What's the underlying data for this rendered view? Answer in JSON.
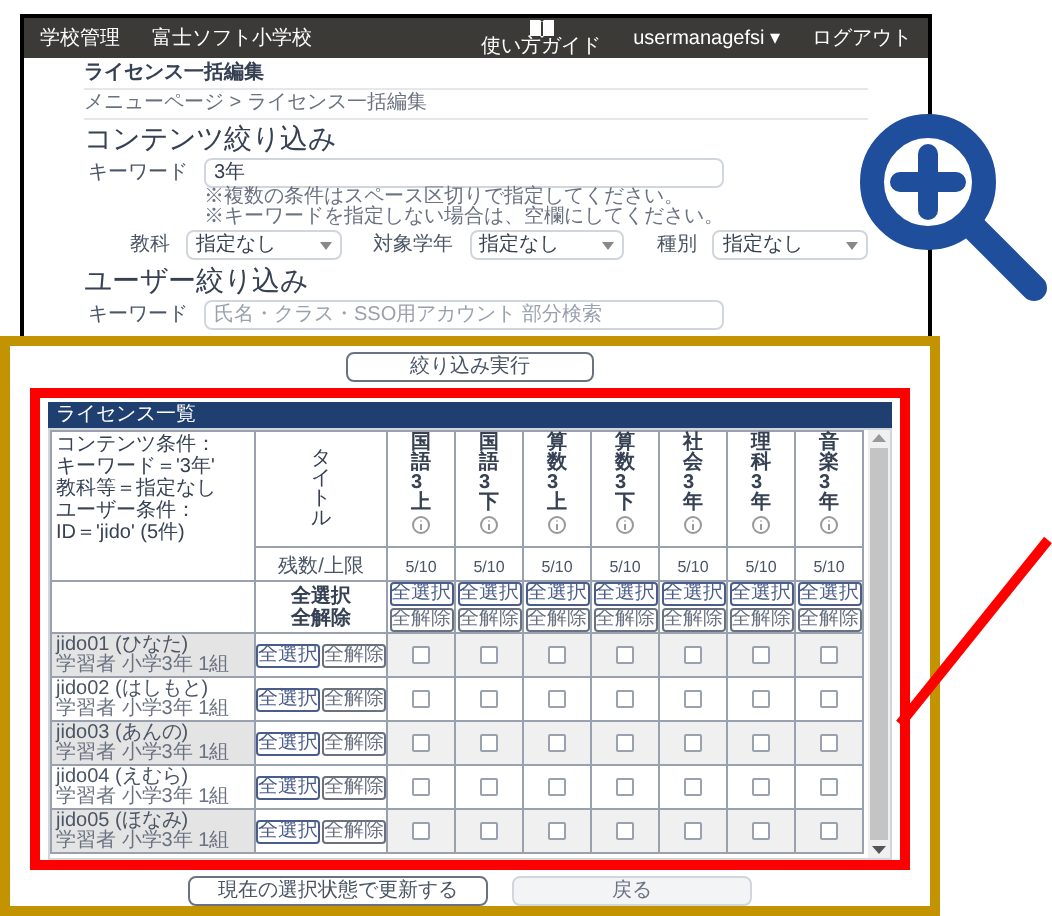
{
  "header": {
    "app": "学校管理",
    "school": "富士ソフト小学校",
    "guide": "使い方ガイド",
    "user": "usermanagefsi ▾",
    "logout": "ログアウト"
  },
  "page_title": "ライセンス一括編集",
  "breadcrumb": "メニューページ > ライセンス一括編集",
  "content_filter": {
    "heading": "コンテンツ絞り込み",
    "keyword": {
      "label": "キーワード",
      "value": "3年"
    },
    "hints": [
      "※複数の条件はスペース区切りで指定してください。",
      "※キーワードを指定しない場合は、空欄にしてください。"
    ],
    "selects": [
      {
        "label": "教科",
        "value": "指定なし"
      },
      {
        "label": "対象学年",
        "value": "指定なし"
      },
      {
        "label": "種別",
        "value": "指定なし"
      }
    ]
  },
  "user_filter": {
    "heading": "ユーザー絞り込み",
    "keyword": {
      "label": "キーワード",
      "placeholder": "氏名・クラス・SSO用アカウント 部分検索"
    }
  },
  "run_button": "絞り込み実行",
  "license_table": {
    "title": "ライセンス一覧",
    "conditions": [
      "コンテンツ条件：",
      "キーワード＝'3年'",
      "教科等＝指定なし",
      "ユーザー条件：",
      "ID＝'jido' (5件)"
    ],
    "title_label": "タイトル",
    "count_label": "残数/上限",
    "select_labels": [
      "全選択",
      "全解除"
    ],
    "columns": [
      {
        "title": "国語3上",
        "count": "5/10",
        "buttons": [
          "全選択",
          "全解除"
        ]
      },
      {
        "title": "国語3下",
        "count": "5/10",
        "buttons": [
          "全選択",
          "全解除"
        ]
      },
      {
        "title": "算数3上",
        "count": "5/10",
        "buttons": [
          "全選択",
          "全解除"
        ]
      },
      {
        "title": "算数3下",
        "count": "5/10",
        "buttons": [
          "全選択",
          "全解除"
        ]
      },
      {
        "title": "社会3年",
        "count": "5/10",
        "buttons": [
          "全選択",
          "全解除"
        ]
      },
      {
        "title": "理科3年",
        "count": "5/10",
        "buttons": [
          "全選択",
          "全解除"
        ]
      },
      {
        "title": "音楽3年",
        "count": "5/10",
        "buttons": [
          "全選択",
          "全解除"
        ]
      }
    ],
    "rows": [
      {
        "user": "jido01 (ひなた)",
        "detail": "学習者 小学3年 1組",
        "buttons": [
          "全選択",
          "全解除"
        ],
        "cells": [
          {
            "checked": false
          },
          {
            "checked": false
          },
          {
            "checked": false
          },
          {
            "checked": false
          },
          {
            "checked": false
          },
          {
            "checked": false
          },
          {
            "checked": false
          }
        ]
      },
      {
        "user": "jido02 (はしもと)",
        "detail": "学習者 小学3年 1組",
        "buttons": [
          "全選択",
          "全解除"
        ],
        "cells": [
          {
            "checked": false
          },
          {
            "checked": false
          },
          {
            "checked": false
          },
          {
            "checked": false
          },
          {
            "checked": false
          },
          {
            "checked": false
          },
          {
            "checked": false
          }
        ]
      },
      {
        "user": "jido03 (あんの)",
        "detail": "学習者 小学3年 1組",
        "buttons": [
          "全選択",
          "全解除"
        ],
        "cells": [
          {
            "checked": false
          },
          {
            "checked": false
          },
          {
            "checked": false
          },
          {
            "checked": false
          },
          {
            "checked": false
          },
          {
            "checked": false
          },
          {
            "checked": false
          }
        ]
      },
      {
        "user": "jido04 (えむら)",
        "detail": "学習者 小学3年 1組",
        "buttons": [
          "全選択",
          "全解除"
        ],
        "cells": [
          {
            "checked": false
          },
          {
            "checked": false
          },
          {
            "checked": false
          },
          {
            "checked": false
          },
          {
            "checked": false
          },
          {
            "checked": false
          },
          {
            "checked": false
          }
        ]
      },
      {
        "user": "jido05 (ほなみ)",
        "detail": "学習者 小学3年 1組",
        "buttons": [
          "全選択",
          "全解除"
        ],
        "cells": [
          {
            "checked": false
          },
          {
            "checked": false
          },
          {
            "checked": false
          },
          {
            "checked": false
          },
          {
            "checked": false
          },
          {
            "checked": false
          },
          {
            "checked": false
          }
        ]
      }
    ]
  },
  "footer_buttons": [
    "現在の選択状態で更新する",
    "戻る"
  ]
}
